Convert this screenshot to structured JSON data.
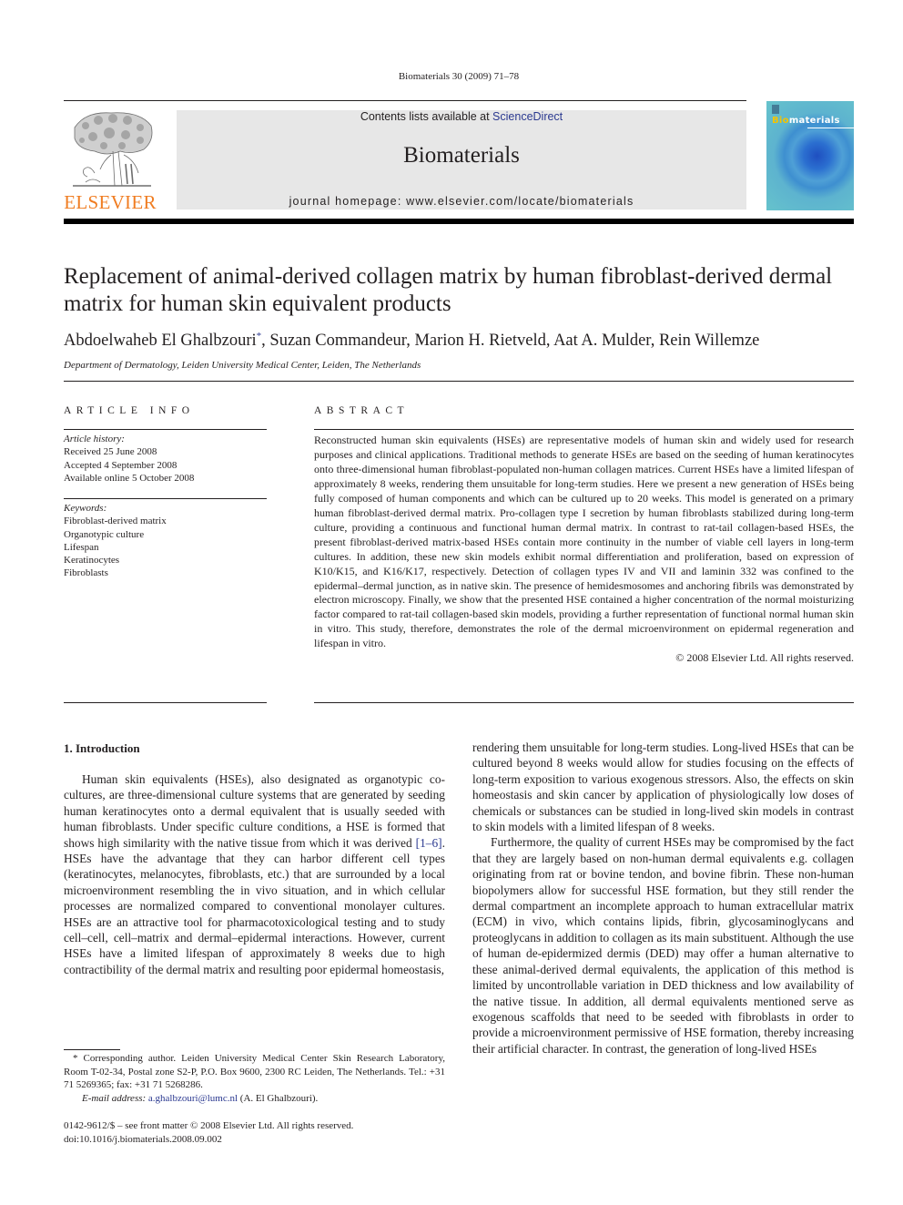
{
  "header": {
    "citation": "Biomaterials 30 (2009) 71–78",
    "contents_prefix": "Contents lists available at ",
    "contents_link": "ScienceDirect",
    "journal_title": "Biomaterials",
    "homepage": "journal homepage: www.elsevier.com/locate/biomaterials",
    "publisher_logo_text": "ELSEVIER",
    "cover": {
      "title_accent": "Bio",
      "title_rest": "materials"
    },
    "colors": {
      "publisher_orange": "#f07d22",
      "link_blue": "#2b3990",
      "band_gray": "#e7e7e7"
    }
  },
  "article": {
    "title": "Replacement of animal-derived collagen matrix by human fibroblast-derived dermal matrix for human skin equivalent products",
    "authors_first": "Abdoelwaheb El Ghalbzouri",
    "authors_star": "*",
    "authors_rest": ", Suzan Commandeur, Marion H. Rietveld, Aat A. Mulder, Rein Willemze",
    "affiliation": "Department of Dermatology, Leiden University Medical Center, Leiden, The Netherlands"
  },
  "article_info": {
    "heading": "ARTICLE INFO",
    "history_label": "Article history:",
    "history": [
      "Received 25 June 2008",
      "Accepted 4 September 2008",
      "Available online 5 October 2008"
    ],
    "keywords_label": "Keywords:",
    "keywords": [
      "Fibroblast-derived matrix",
      "Organotypic culture",
      "Lifespan",
      "Keratinocytes",
      "Fibroblasts"
    ]
  },
  "abstract": {
    "heading": "ABSTRACT",
    "text": "Reconstructed human skin equivalents (HSEs) are representative models of human skin and widely used for research purposes and clinical applications. Traditional methods to generate HSEs are based on the seeding of human keratinocytes onto three-dimensional human fibroblast-populated non-human collagen matrices. Current HSEs have a limited lifespan of approximately 8 weeks, rendering them unsuitable for long-term studies. Here we present a new generation of HSEs being fully composed of human components and which can be cultured up to 20 weeks. This model is generated on a primary human fibroblast-derived dermal matrix. Pro-collagen type I secretion by human fibroblasts stabilized during long-term culture, providing a continuous and functional human dermal matrix. In contrast to rat-tail collagen-based HSEs, the present fibroblast-derived matrix-based HSEs contain more continuity in the number of viable cell layers in long-term cultures. In addition, these new skin models exhibit normal differentiation and proliferation, based on expression of K10/K15, and K16/K17, respectively. Detection of collagen types IV and VII and laminin 332 was confined to the epidermal–dermal junction, as in native skin. The presence of hemidesmosomes and anchoring fibrils was demonstrated by electron microscopy. Finally, we show that the presented HSE contained a higher concentration of the normal moisturizing factor compared to rat-tail collagen-based skin models, providing a further representation of functional normal human skin in vitro. This study, therefore, demonstrates the role of the dermal microenvironment on epidermal regeneration and lifespan in vitro.",
    "copyright": "© 2008 Elsevier Ltd. All rights reserved."
  },
  "introduction": {
    "heading": "1.  Introduction",
    "p1_a": "Human skin equivalents (HSEs), also designated as organotypic co-cultures, are three-dimensional culture systems that are generated by seeding human keratinocytes onto a dermal equiva­lent that is usually seeded with human fibroblasts. Under specific culture conditions, a HSE is formed that shows high similarity with the native tissue from which it was derived ",
    "p1_ref": "[1–6]",
    "p1_b": ". HSEs have the advantage that they can harbor different cell types (keratinocytes, melanocytes, fibroblasts, etc.) that are surrounded by a local microenvironment resembling the in vivo situation, and in which cellular processes are normalized compared to conventional monolayer cultures. HSEs are an attractive tool for pharmacotoxi­cological testing and to study cell–cell, cell–matrix and dermal–epidermal interactions. However, current HSEs have a limited lifespan of approximately 8 weeks due to high contractibility of the dermal matrix and resulting poor epidermal homeostasis,",
    "p1_cont": "rendering them unsuitable for long-term studies. Long-lived HSEs that can be cultured beyond 8 weeks would allow for studies focusing on the effects of long-term exposition to various exoge­nous stressors. Also, the effects on skin homeostasis and skin cancer by application of physiologically low doses of chemicals or substances can be studied in long-lived skin models in contrast to skin models with a limited lifespan of 8 weeks.",
    "p2": "Furthermore, the quality of current HSEs may be compromised by the fact that they are largely based on non-human dermal equivalents e.g. collagen originating from rat or bovine tendon, and bovine fibrin. These non-human biopolymers allow for successful HSE formation, but they still render the dermal compartment an incomplete approach to human extracellular matrix (ECM) in vivo, which contains lipids, fibrin, glycosaminoglycans and proteogly­cans in addition to collagen as its main substituent. Although the use of human de-epidermized dermis (DED) may offer a human alternative to these animal-derived dermal equivalents, the appli­cation of this method is limited by uncontrollable variation in DED thickness and low availability of the native tissue. In addition, all dermal equivalents mentioned serve as exogenous scaffolds that need to be seeded with fibroblasts in order to provide a microen­vironment permissive of HSE formation, thereby increasing their artificial character. In contrast, the generation of long-lived HSEs"
  },
  "footnote": {
    "star": "*",
    "text": " Corresponding author. Leiden University Medical Center Skin Research Labo­ratory, Room T-02-34, Postal zone S2-P, P.O. Box 9600, 2300 RC Leiden, The Neth­erlands. Tel.: +31 71 5269365; fax: +31 71 5268286.",
    "email_label": "E-mail address:",
    "email": "a.ghalbzouri@lumc.nl",
    "email_suffix": " (A. El Ghalbzouri)."
  },
  "front_matter": {
    "issn_line": "0142-9612/$ – see front matter © 2008 Elsevier Ltd. All rights reserved.",
    "doi": "doi:10.1016/j.biomaterials.2008.09.002"
  }
}
